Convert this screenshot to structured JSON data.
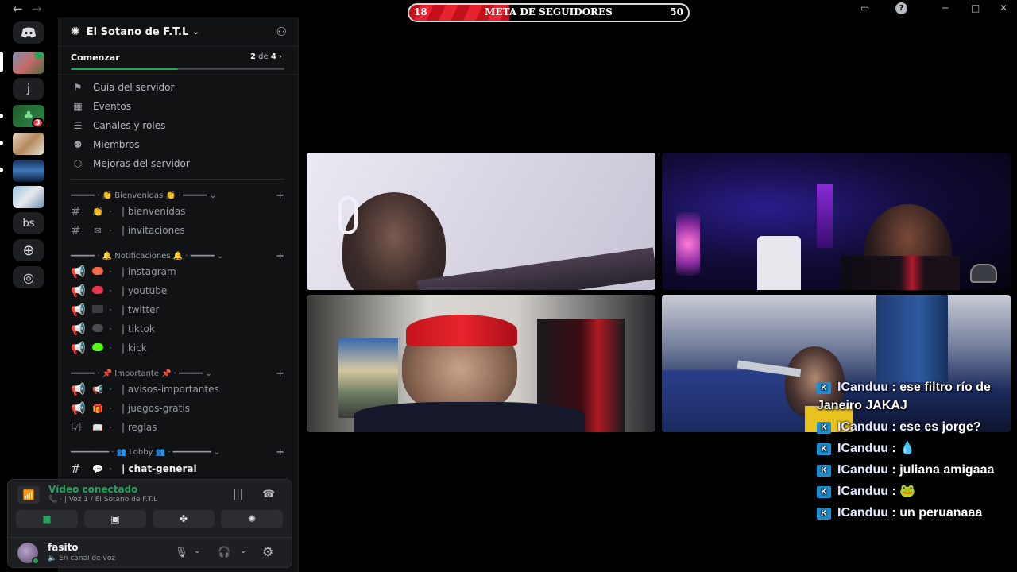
{
  "window": {
    "back_icon": "arrow-left-icon",
    "forward_icon": "arrow-right-icon",
    "controls": [
      "inbox-icon",
      "help-icon",
      "minimize-icon",
      "maximize-icon",
      "close-icon"
    ]
  },
  "overlay_goal": {
    "current": "18",
    "title": "META DE SEGUIDORES",
    "target": "50",
    "progress_fraction": 0.36
  },
  "server_rail": {
    "items": [
      {
        "label": "",
        "icon": "discord-logo-icon"
      },
      {
        "label": "",
        "icon": "server-avatar-1"
      },
      {
        "label": "j",
        "icon": ""
      },
      {
        "label": "",
        "icon": "server-avatar-3",
        "badge": "3"
      },
      {
        "label": "",
        "icon": "server-avatar-4"
      },
      {
        "label": "",
        "icon": "server-avatar-5"
      },
      {
        "label": "",
        "icon": "server-avatar-6"
      },
      {
        "label": "bs",
        "icon": ""
      },
      {
        "label": "",
        "icon": "add-server-icon"
      },
      {
        "label": "",
        "icon": "explore-icon"
      }
    ]
  },
  "sidebar": {
    "server_name": "El Sotano de F.T.L",
    "progress": {
      "label": "Comenzar",
      "done": "2",
      "sep": "de",
      "total": "4",
      "fraction": 0.5
    },
    "menu": [
      {
        "label": "Guía del servidor",
        "icon": "signpost-icon"
      },
      {
        "label": "Eventos",
        "icon": "calendar-icon"
      },
      {
        "label": "Canales y roles",
        "icon": "list-search-icon"
      },
      {
        "label": "Miembros",
        "icon": "members-icon"
      },
      {
        "label": "Mejoras del servidor",
        "icon": "boost-icon"
      }
    ],
    "categories": [
      {
        "label": "━━━━━ · 👏 Bienvenidas 👏 · ━━━━━ ⌄"
      },
      {
        "label": "━━━━━ · 🔔 Notificaciones 🔔 · ━━━━━ ⌄"
      },
      {
        "label": "━━━━━ · 📌 Importante 📌 · ━━━━━ ⌄"
      },
      {
        "label": "━━━━━━━━ · 👥 Lobby 👥 · ━━━━━━━━ ⌄"
      }
    ],
    "channels": [
      {
        "name": "| bienvenidas",
        "emoji": "👏"
      },
      {
        "name": "| invitaciones",
        "emoji": "✉"
      },
      {
        "name": "| instagram",
        "color": "#f0694a"
      },
      {
        "name": "| youtube",
        "color": "#e8364f"
      },
      {
        "name": "| twitter",
        "color": "#2b2d31"
      },
      {
        "name": "| tiktok",
        "color": "#3a3c42"
      },
      {
        "name": "| kick",
        "color": "#53fc18"
      },
      {
        "name": "| avisos-importantes",
        "emoji": "📢"
      },
      {
        "name": "| juegos-gratis",
        "emoji": "🎁"
      },
      {
        "name": "| reglas",
        "emoji": "📖"
      },
      {
        "name": "| chat-general",
        "emoji": "💬"
      }
    ]
  },
  "voice": {
    "status": "Vídeo conectado",
    "location": "| Voz 1 / El Sotano de F.T.L",
    "buttons": [
      "camera-icon",
      "screen-share-icon",
      "activities-icon",
      "soundboard-icon"
    ]
  },
  "user": {
    "name": "fasito",
    "status": "En canal de voz"
  },
  "chat_overlay": [
    {
      "user": "ICanduu",
      "text": "ese filtro río de Janeiro JAKAJ"
    },
    {
      "user": "ICanduu",
      "text": "ese es jorge?"
    },
    {
      "user": "ICanduu",
      "text": "💧"
    },
    {
      "user": "ICanduu",
      "text": "juliana amigaaa"
    },
    {
      "user": "ICanduu",
      "text": "🐸"
    },
    {
      "user": "ICanduu",
      "text": "un peruanaaa"
    }
  ]
}
